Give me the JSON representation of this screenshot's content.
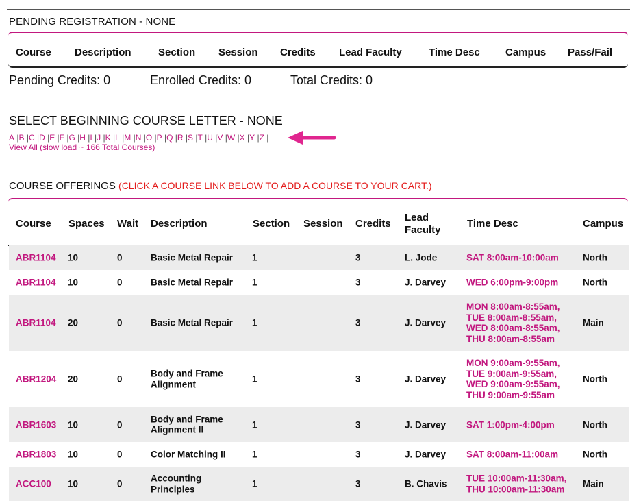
{
  "pending": {
    "title": "PENDING REGISTRATION - NONE",
    "columns": [
      "Course",
      "Description",
      "Section",
      "Session",
      "Credits",
      "Lead Faculty",
      "Time Desc",
      "Campus",
      "Pass/Fail"
    ],
    "pending_credits": "Pending Credits: 0",
    "enrolled_credits": "Enrolled Credits: 0",
    "total_credits": "Total Credits: 0"
  },
  "letters": {
    "title": "SELECT BEGINNING COURSE LETTER - NONE",
    "items": [
      "A",
      "B",
      "C",
      "D",
      "E",
      "F",
      "G",
      "H",
      "I",
      "J",
      "K",
      "L",
      "M",
      "N",
      "O",
      "P",
      "Q",
      "R",
      "S",
      "T",
      "U",
      "V",
      "W",
      "X",
      "Y",
      "Z"
    ],
    "view_all": "View All (slow load ~ 166 Total Courses)",
    "arrow_color": "#e0268f"
  },
  "offerings": {
    "title": "COURSE OFFERINGS",
    "hint": "(CLICK A COURSE LINK BELOW TO ADD A COURSE TO YOUR CART.)",
    "columns": {
      "course": "Course",
      "spaces": "Spaces",
      "wait": "Wait",
      "description": "Description",
      "section": "Section",
      "session": "Session",
      "credits": "Credits",
      "lead1": "Lead",
      "lead2": "Faculty",
      "time": "Time Desc",
      "campus": "Campus"
    },
    "rows": [
      {
        "course": "ABR1104",
        "spaces": "10",
        "wait": "0",
        "desc": [
          "Basic Metal Repair"
        ],
        "section": "1",
        "session": "",
        "credits": "3",
        "faculty": "L. Jode",
        "time": [
          "SAT 8:00am-10:00am"
        ],
        "campus": "North"
      },
      {
        "course": "ABR1104",
        "spaces": "10",
        "wait": "0",
        "desc": [
          "Basic Metal Repair"
        ],
        "section": "1",
        "session": "",
        "credits": "3",
        "faculty": "J. Darvey",
        "time": [
          "WED 6:00pm-9:00pm"
        ],
        "campus": "North"
      },
      {
        "course": "ABR1104",
        "spaces": "20",
        "wait": "0",
        "desc": [
          "Basic Metal Repair"
        ],
        "section": "1",
        "session": "",
        "credits": "3",
        "faculty": "J. Darvey",
        "time": [
          "MON 8:00am-8:55am,",
          "TUE 8:00am-8:55am,",
          "WED 8:00am-8:55am,",
          "THU 8:00am-8:55am"
        ],
        "campus": "Main"
      },
      {
        "course": "ABR1204",
        "spaces": "20",
        "wait": "0",
        "desc": [
          "Body and Frame",
          "Alignment"
        ],
        "section": "1",
        "session": "",
        "credits": "3",
        "faculty": "J. Darvey",
        "time": [
          "MON 9:00am-9:55am,",
          "TUE 9:00am-9:55am,",
          "WED 9:00am-9:55am,",
          "THU 9:00am-9:55am"
        ],
        "campus": "North"
      },
      {
        "course": "ABR1603",
        "spaces": "10",
        "wait": "0",
        "desc": [
          "Body and Frame",
          "Alignment II"
        ],
        "section": "1",
        "session": "",
        "credits": "3",
        "faculty": "J. Darvey",
        "time": [
          "SAT 1:00pm-4:00pm"
        ],
        "campus": "North"
      },
      {
        "course": "ABR1803",
        "spaces": "10",
        "wait": "0",
        "desc": [
          "Color Matching II"
        ],
        "section": "1",
        "session": "",
        "credits": "3",
        "faculty": "J. Darvey",
        "time": [
          "SAT 8:00am-11:00am"
        ],
        "campus": "North"
      },
      {
        "course": "ACC100",
        "spaces": "10",
        "wait": "0",
        "desc": [
          "Accounting",
          "Principles"
        ],
        "section": "1",
        "session": "",
        "credits": "3",
        "faculty": "B. Chavis",
        "time": [
          "TUE 10:00am-11:30am,",
          "THU 10:00am-11:30am"
        ],
        "campus": "Main"
      }
    ]
  }
}
